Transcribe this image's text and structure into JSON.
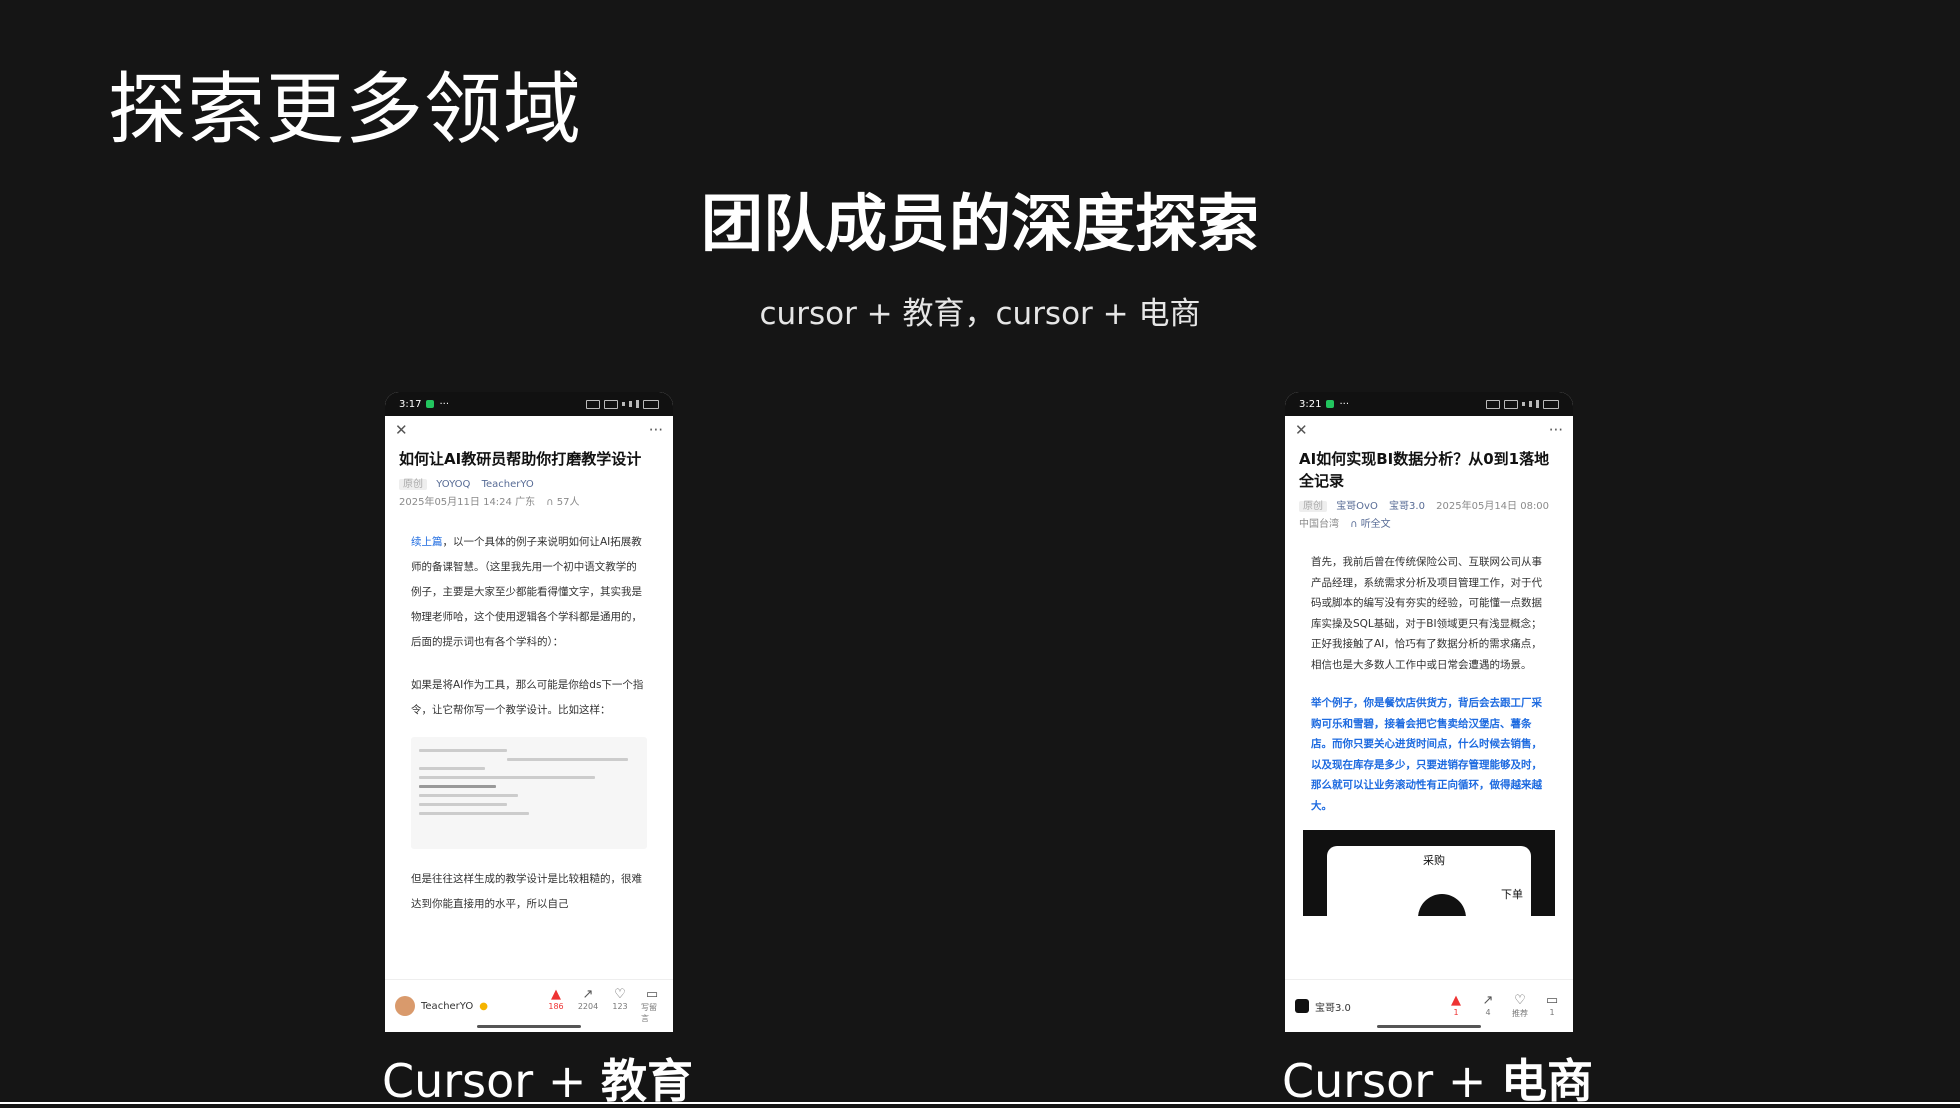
{
  "slide": {
    "title": "探索更多领域",
    "headline": "团队成员的深度探索",
    "subheadline": "cursor + 教育，cursor + 电商"
  },
  "left_phone": {
    "status_time": "3:17",
    "status_extra": "···",
    "nav_more": "···",
    "article_title": "如何让AI教研员帮助你打磨教学设计",
    "meta_tag": "原创",
    "author_1": "YOYOQ",
    "author_2": "TeacherYO",
    "date_line": "2025年05月11日 14:24  广东",
    "listen_count": "57人",
    "para1_link": "续上篇",
    "para1": "，以一个具体的例子来说明如何让AI拓展教师的备课智慧。（这里我先用一个初中语文教学的例子，主要是大家至少都能看得懂文字，其实我是物理老师哈，这个使用逻辑各个学科都是通用的，后面的提示词也有各个学科的）：",
    "para2": "如果是将AI作为工具，那么可能是你给ds下一个指令，让它帮你写一个教学设计。比如这样：",
    "para3": "但是往往这样生成的教学设计是比较粗糙的，很难达到你能直接用的水平，所以自己",
    "bottom_author": "TeacherYO",
    "like_count": "186",
    "share_count": "2204",
    "fav_count": "123",
    "comment_label": "写留言"
  },
  "right_phone": {
    "status_time": "3:21",
    "status_extra": "···",
    "nav_more": "···",
    "article_title": "AI如何实现BI数据分析？从0到1落地全记录",
    "meta_tag": "原创",
    "author_1": "宝哥OvO",
    "author_2": "宝哥3.0",
    "date_line": "2025年05月14日 08:00",
    "region": "中国台湾",
    "listen_label": "听全文",
    "para1": "首先，我前后曾在传统保险公司、互联网公司从事产品经理，系统需求分析及项目管理工作，对于代码或脚本的编写没有夯实的经验，可能懂一点数据库实操及SQL基础，对于BI领域更只有浅显概念；正好我接触了AI，恰巧有了数据分析的需求痛点，相信也是大多数人工作中或日常会遭遇的场景。",
    "para2": "举个例子，你是餐饮店供货方，背后会去跟工厂采购可乐和雪碧，接着会把它售卖给汉堡店、薯条店。而你只要关心进货时间点，什么时候去销售，以及现在库存是多少，只要进销存管理能够及时，那么就可以让业务滚动性有正向循环，做得越来越大。",
    "diagram_label_1": "采购",
    "diagram_label_2": "下单",
    "bottom_author": "宝哥3.0",
    "like_count": "1",
    "share_count": "4",
    "fav_label": "推荐",
    "comment_count": "1"
  },
  "captions": {
    "left_prefix": "Cursor + ",
    "left_bold": "教育",
    "right_prefix": "Cursor + ",
    "right_bold": "电商"
  }
}
